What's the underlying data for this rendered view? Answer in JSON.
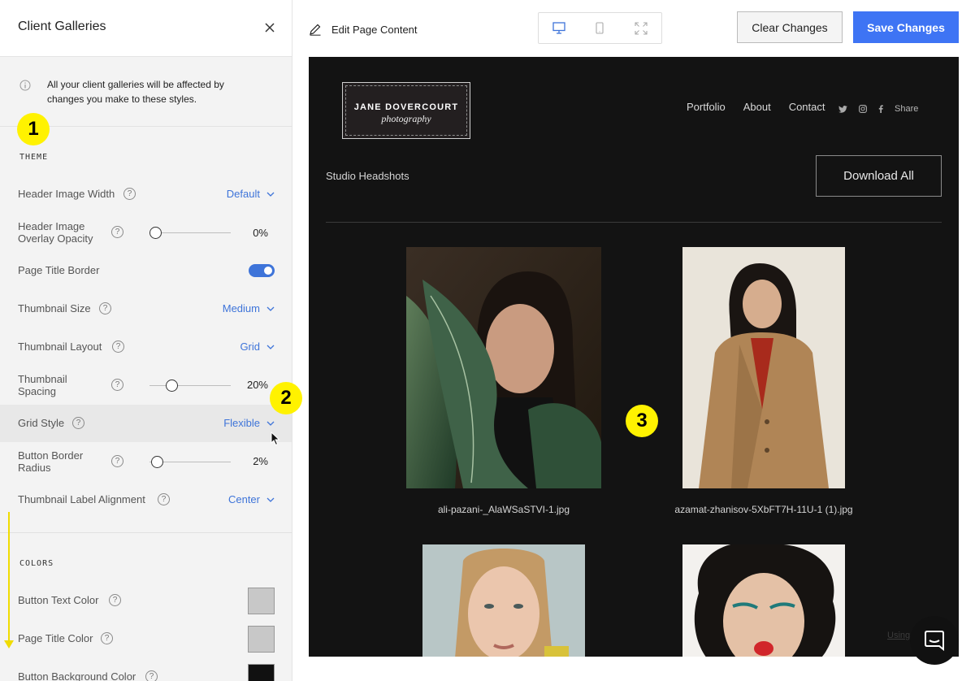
{
  "sidebar": {
    "title": "Client Galleries",
    "info_text": "All your client galleries will be affected by changes you make to these styles.",
    "theme_label": "THEME",
    "colors_label": "COLORS",
    "settings": {
      "header_image_width": {
        "label": "Header Image Width",
        "value": "Default"
      },
      "header_overlay": {
        "label": "Header Image Overlay Opacity",
        "value": "0%",
        "level": 0
      },
      "page_title_border": {
        "label": "Page Title Border",
        "enabled": true
      },
      "thumbnail_size": {
        "label": "Thumbnail Size",
        "value": "Medium"
      },
      "thumbnail_layout": {
        "label": "Thumbnail Layout",
        "value": "Grid"
      },
      "thumbnail_spacing": {
        "label": "Thumbnail Spacing",
        "value": "20%",
        "level": 20
      },
      "grid_style": {
        "label": "Grid Style",
        "value": "Flexible"
      },
      "button_border_radius": {
        "label": "Button Border Radius",
        "value": "2%",
        "level": 2
      },
      "thumbnail_label_alignment": {
        "label": "Thumbnail Label Alignment",
        "value": "Center"
      }
    },
    "colors": {
      "button_text_color": {
        "label": "Button Text Color",
        "color": "#c8c8c8"
      },
      "page_title_color": {
        "label": "Page Title Color",
        "color": "#c8c8c8"
      },
      "button_background_color": {
        "label": "Button Background Color",
        "color": "#111111"
      }
    },
    "help_glyph": "?"
  },
  "markers": {
    "one": "1",
    "two": "2",
    "three": "3"
  },
  "topbar": {
    "edit_label": "Edit Page Content",
    "clear_label": "Clear Changes",
    "save_label": "Save Changes"
  },
  "preview": {
    "logo_name": "JANE DOVERCOURT",
    "logo_sub": "photography",
    "nav": [
      "Portfolio",
      "About",
      "Contact"
    ],
    "share_label": "Share",
    "gallery_title": "Studio Headshots",
    "download_label": "Download All",
    "images": [
      {
        "caption": "ali-pazani-_AlaWSaSTVI-1.jpg"
      },
      {
        "caption": "azamat-zhanisov-5XbFT7H-11U-1 (1).jpg"
      }
    ],
    "using_label": "Using"
  },
  "colors": {
    "accent": "#3e74d9",
    "save_button": "#3e74f4",
    "marker": "#fff200",
    "preview_bg": "#131313"
  }
}
